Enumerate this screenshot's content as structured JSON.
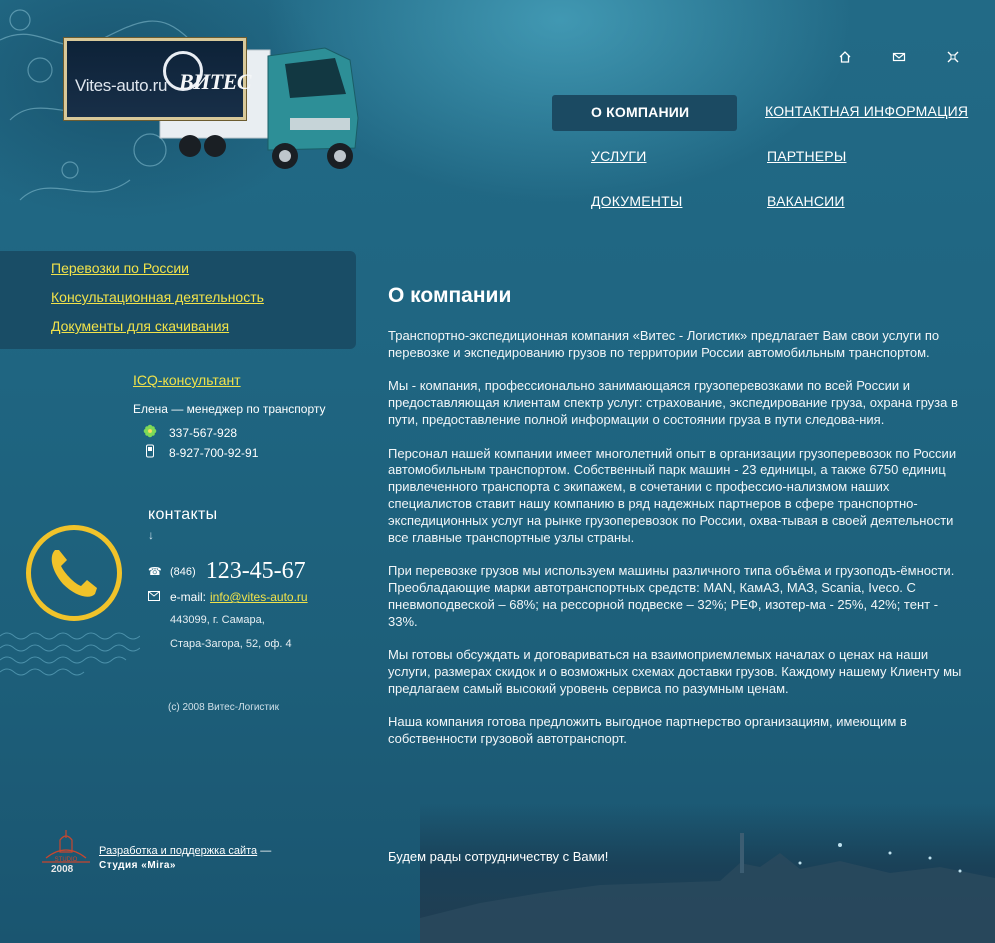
{
  "logo": {
    "site": "Vites-auto.ru",
    "brand": "ВИТЕС"
  },
  "top_icons": [
    "home-icon",
    "mail-icon",
    "sitemap-icon"
  ],
  "nav": {
    "items": [
      {
        "label": "О КОМПАНИИ",
        "active": true
      },
      {
        "label": "КОНТАКТНАЯ ИНФОРМАЦИЯ",
        "active": false
      },
      {
        "label": "УСЛУГИ",
        "active": false
      },
      {
        "label": "ПАРТНЕРЫ",
        "active": false
      },
      {
        "label": "ДОКУМЕНТЫ",
        "active": false
      },
      {
        "label": "ВАКАНСИИ",
        "active": false
      }
    ]
  },
  "sidebar": {
    "links": [
      "Перевозки по России",
      "Консультационная деятельность",
      "Документы для скачивания"
    ]
  },
  "icq": {
    "title": "ICQ-консультант",
    "name": "Елена — менеджер по транспорту",
    "icq_number": "337-567-928",
    "mobile": "8-927-700-92-91"
  },
  "contacts": {
    "title": "контакты",
    "arrow": "↓",
    "phone_code": "(846)",
    "phone": "123-45-67",
    "email_label": "e-mail:",
    "email": "info@vites-auto.ru",
    "address_line1": "443099, г. Самара,",
    "address_line2": "Стара-Загора, 52, оф. 4"
  },
  "copyright": "(c) 2008 Витес-Логистик",
  "developer": {
    "year": "2008",
    "link_text": "Разработка  и поддержка сайта",
    "dash": " —",
    "studio": "Студия «Mira»"
  },
  "main": {
    "title": "О компании",
    "paragraphs": [
      "Транспортно-экспедиционная компания «Витес - Логистик» предлагает Вам свои услуги по перевозке и экспедированию грузов по территории России автомобильным транспортом.",
      "Мы - компания, профессионально занимающаяся грузоперевозками по всей России и предоставляющая клиентам спектр услуг: страхование, экспедирование груза, охрана груза в пути, предоставление полной информации о состоянии груза в пути следова-ния.",
      "Персонал нашей компании имеет многолетний опыт в организации грузоперевозок по России автомобильным транспортом. Собственный парк машин - 23 единицы, а также 6750 единиц привлеченного транспорта с экипажем, в сочетании с профессио-нализмом наших специалистов ставит нашу компанию в ряд надежных партнеров в сфере транспортно-экспедиционных услуг на рынке грузоперевозок по России, охва-тывая в своей деятельности все главные транспортные узлы страны.",
      "При перевозке грузов мы используем машины различного типа объёма и грузоподъ-ёмности. Преобладающие марки автотранспортных средств: MAN, КамАЗ, МАЗ, Scania, Iveco. С пневмоподвеской – 68%; на рессорной подвеске – 32%; РЕФ, изотер-ма - 25%, 42%; тент  - 33%.",
      "Мы готовы обсуждать и договариваться на взаимоприемлемых началах о ценах на наши услуги, размерах скидок и о возможных схемах доставки грузов. Каждому нашему Клиенту мы предлагаем самый высокий уровень сервиса по разумным ценам.",
      "Наша компания готова предложить выгодное партнерство организациям, имеющим в собственности грузовой автотранспорт."
    ],
    "closing": "Будем рады сотрудничеству с Вами!"
  }
}
